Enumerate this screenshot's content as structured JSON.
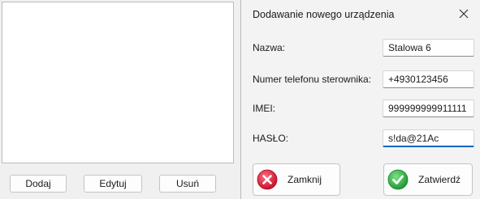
{
  "main": {
    "buttons": {
      "add": "Dodaj",
      "edit": "Edytuj",
      "remove": "Usuń"
    }
  },
  "dialog": {
    "title": "Dodawanie nowego urządzenia",
    "fields": {
      "name": {
        "label": "Nazwa:",
        "value": "Stalowa 6"
      },
      "phone": {
        "label": "Numer telefonu sterownika:",
        "value": "+4930123456"
      },
      "imei": {
        "label": "IMEI:",
        "value": "999999999911111"
      },
      "password": {
        "label": "HASŁO:",
        "value": "s!da@21Ac"
      }
    },
    "buttons": {
      "close": {
        "label": "Zamknij",
        "icon": "close-circle-icon",
        "color": "#e0243c"
      },
      "confirm": {
        "label": "Zatwierdź",
        "icon": "check-circle-icon",
        "color": "#2eaf3c"
      }
    }
  }
}
